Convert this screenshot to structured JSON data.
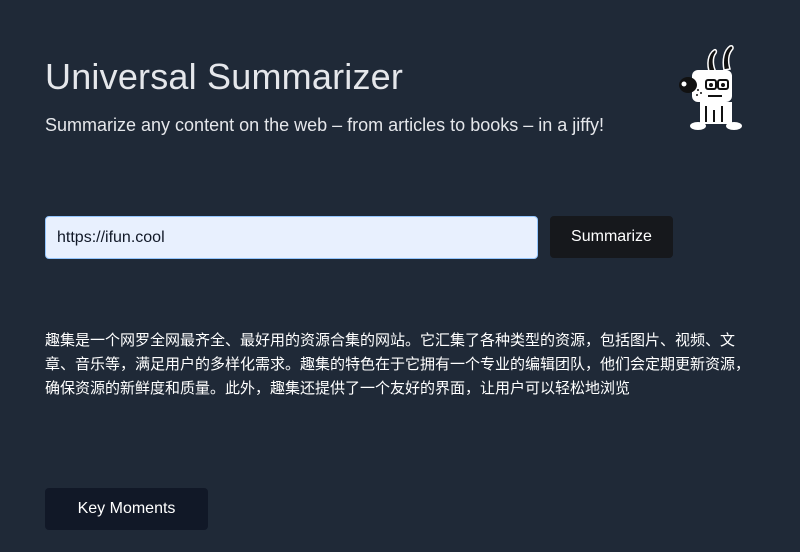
{
  "header": {
    "title": "Universal Summarizer",
    "subtitle": "Summarize any content on the web – from articles to books – in a jiffy!",
    "mascot_icon": "dog-mascot-icon"
  },
  "form": {
    "url_value": "https://ifun.cool",
    "submit_label": "Summarize"
  },
  "summary": {
    "text": "趣集是一个网罗全网最齐全、最好用的资源合集的网站。它汇集了各种类型的资源，包括图片、视频、文章、音乐等，满足用户的多样化需求。趣集的特色在于它拥有一个专业的编辑团队，他们会定期更新资源，确保资源的新鲜度和质量。此外，趣集还提供了一个友好的界面，让用户可以轻松地浏览"
  },
  "actions": {
    "key_moments_label": "Key Moments"
  },
  "colors": {
    "background": "#1f2937",
    "input_background": "#e8f0fe",
    "button_background": "#16181c"
  }
}
